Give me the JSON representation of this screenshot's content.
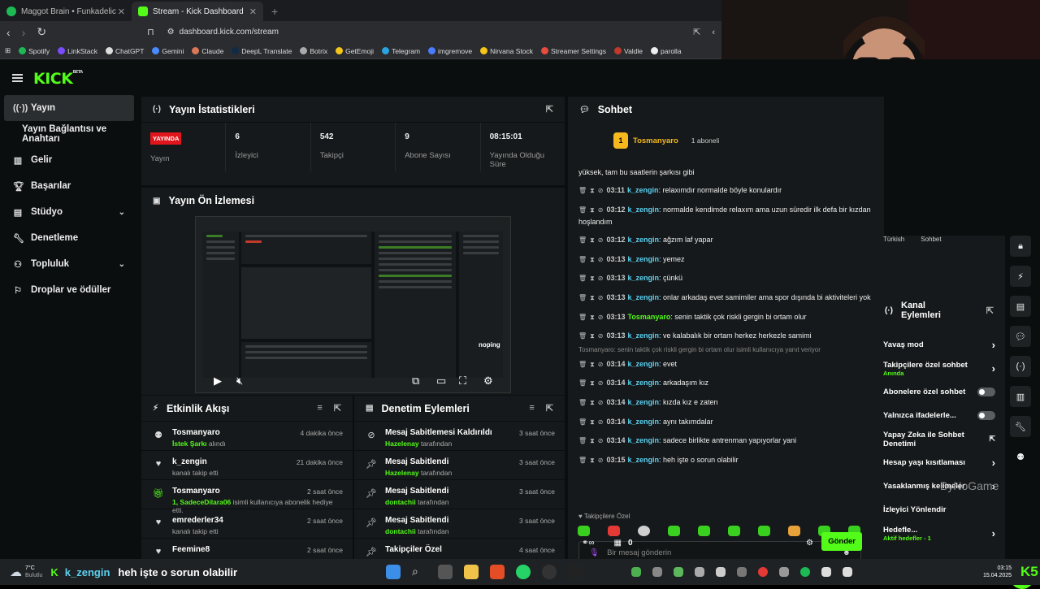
{
  "browser": {
    "tabs": [
      {
        "title": "Maggot Brain • Funkadelic",
        "active": false
      },
      {
        "title": "Stream - Kick Dashboard",
        "active": true
      }
    ],
    "url": "dashboard.kick.com/stream",
    "bookmarks": [
      "Spotify",
      "LinkStack",
      "ChatGPT",
      "Gemini",
      "Claude",
      "DeepL Translate",
      "Botrix",
      "GetEmoji",
      "Telegram",
      "imgremove",
      "Nirvana Stock",
      "Streamer Settings",
      "Valdle",
      "parolla"
    ]
  },
  "logo": "KICK",
  "logo_badge": "BETA",
  "sidebar": {
    "items": [
      {
        "label": "Yayın",
        "active": true
      },
      {
        "label": "Yayın Bağlantısı ve Anahtarı"
      },
      {
        "label": "Gelir"
      },
      {
        "label": "Başarılar"
      },
      {
        "label": "Stüdyo",
        "expandable": true
      },
      {
        "label": "Denetleme"
      },
      {
        "label": "Topluluk",
        "expandable": true
      },
      {
        "label": "Droplar ve ödüller"
      }
    ]
  },
  "stats": {
    "title": "Yayın İstatistikleri",
    "live_badge": "YAYINDA",
    "items": [
      {
        "value": "",
        "label": "Yayın"
      },
      {
        "value": "6",
        "label": "İzleyici"
      },
      {
        "value": "542",
        "label": "Takipçi"
      },
      {
        "value": "9",
        "label": "Abone Sayısı"
      },
      {
        "value": "08:15:01",
        "label": "Yayında Olduğu Süre"
      }
    ]
  },
  "preview": {
    "title": "Yayın Ön İzlemesi",
    "overlay": "noping"
  },
  "activity": {
    "title": "Etkinlik Akışı",
    "rows": [
      {
        "name": "Tosmanyaro",
        "detail_hl": "İstek Şarkı",
        "detail": " alındı",
        "time": "4 dakika önce"
      },
      {
        "name": "k_zengin",
        "detail_hl": "",
        "detail": "kanalı takip etti",
        "time": "21 dakika önce"
      },
      {
        "name": "Tosmanyaro",
        "detail_hl": "1, SadeceDilara06",
        "detail": " isimli kullanıcıya abonelik hediye etti.",
        "time": "2 saat önce"
      },
      {
        "name": "emrederler34",
        "detail_hl": "",
        "detail": "kanalı takip etti",
        "time": "2 saat önce"
      },
      {
        "name": "Feemine8",
        "detail_hl": "",
        "detail": "",
        "time": "2 saat önce"
      }
    ]
  },
  "moderation": {
    "title": "Denetim Eylemleri",
    "rows": [
      {
        "action": "Mesaj Sabitlemesi Kaldırıldı",
        "by": "Hazelenay",
        "suffix": " tarafından",
        "time": "3 saat önce"
      },
      {
        "action": "Mesaj Sabitlendi",
        "by": "Hazelenay",
        "suffix": " tarafından",
        "time": "3 saat önce"
      },
      {
        "action": "Mesaj Sabitlendi",
        "by": "dontachii",
        "suffix": " tarafından",
        "time": "3 saat önce"
      },
      {
        "action": "Mesaj Sabitlendi",
        "by": "dontachii",
        "suffix": " tarafından",
        "time": "3 saat önce"
      },
      {
        "action": "Takipçiler Özel",
        "by": "",
        "suffix": "",
        "time": "4 saat önce"
      }
    ]
  },
  "chat": {
    "title": "Sohbet",
    "pinned_user": "Tosmanyaro",
    "pinned_sub": "1",
    "sub_count": "1 aboneli",
    "top_text": "yüksek, tam bu saatlerin şarkısı gibi",
    "messages": [
      {
        "ts": "03:11",
        "user": "k_zengin",
        "text": ": relaxımdır normalde böyle konulardır"
      },
      {
        "ts": "03:12",
        "user": "k_zengin",
        "text": ": normalde kendimde relaxım ama uzun süredir ilk defa bir kızdan hoşlandım"
      },
      {
        "ts": "03:12",
        "user": "k_zengin",
        "text": ": ağzım laf yapar"
      },
      {
        "ts": "03:13",
        "user": "k_zengin",
        "text": ": yemez"
      },
      {
        "ts": "03:13",
        "user": "k_zengin",
        "text": ": çünkü"
      },
      {
        "ts": "03:13",
        "user": "k_zengin",
        "text": ": onlar arkadaş evet samimiler ama spor dışında bi aktiviteleri yok"
      },
      {
        "ts": "03:13",
        "user": "Tosmanyaro",
        "text": ": senin taktik çok riskli gergin bi ortam olur",
        "green": true
      },
      {
        "ts": "03:13",
        "user": "k_zengin",
        "text": ": ve kalabalık bir ortam herkez herkezle samimi"
      },
      {
        "reply": "Tosmanyaro: senin taktik çok riskli gergin bi ortam olur isimli kullanıcıya yanıt veriyor"
      },
      {
        "ts": "03:14",
        "user": "k_zengin",
        "text": ": evet"
      },
      {
        "ts": "03:14",
        "user": "k_zengin",
        "text": ": arkadaşım kız"
      },
      {
        "ts": "03:14",
        "user": "k_zengin",
        "text": ": kızda kız e zaten"
      },
      {
        "ts": "03:14",
        "user": "k_zengin",
        "text": ": aynı takımdalar"
      },
      {
        "ts": "03:14",
        "user": "k_zengin",
        "text": ": sadece birlikte antrenman yapıyorlar yani"
      },
      {
        "ts": "03:15",
        "user": "k_zengin",
        "text": ": heh işte o sorun olabilir"
      }
    ],
    "mode_label": "Takipçilere Özel",
    "input_placeholder": "Bir mesaj gönderin",
    "points": "0",
    "send": "Gönder"
  },
  "channel_actions": {
    "tags": [
      "Türkish",
      "Sohbet"
    ],
    "title": "Kanal Eylemleri",
    "rows": [
      {
        "label": "Yavaş mod",
        "type": "chevron"
      },
      {
        "label": "Takipçilere özel sohbet",
        "sub": "Anında",
        "type": "chevron"
      },
      {
        "label": "Abonelere özel sohbet",
        "type": "toggle"
      },
      {
        "label": "Yalnızca ifadelerle...",
        "type": "toggle"
      },
      {
        "label": "Yapay Zeka ile Sohbet Denetimi",
        "type": "link"
      },
      {
        "label": "Hesap yaşı kısıtlaması",
        "type": "chevron"
      },
      {
        "label": "Yasaklanmış kelimeler",
        "type": "chevron"
      },
      {
        "label": "İzleyici Yönlendir",
        "type": "none"
      },
      {
        "label": "Hedefle...",
        "sub": "Aktif hedefler - 1",
        "type": "chevron"
      }
    ],
    "watermark": "ByNoGame"
  },
  "taskbar": {
    "weather_temp": "7°C",
    "weather_label": "Bulutlu",
    "ticker_user": "k_zengin",
    "ticker_text": "heh işte o sorun olabilir",
    "time": "03:15",
    "date": "15.04.2025"
  }
}
